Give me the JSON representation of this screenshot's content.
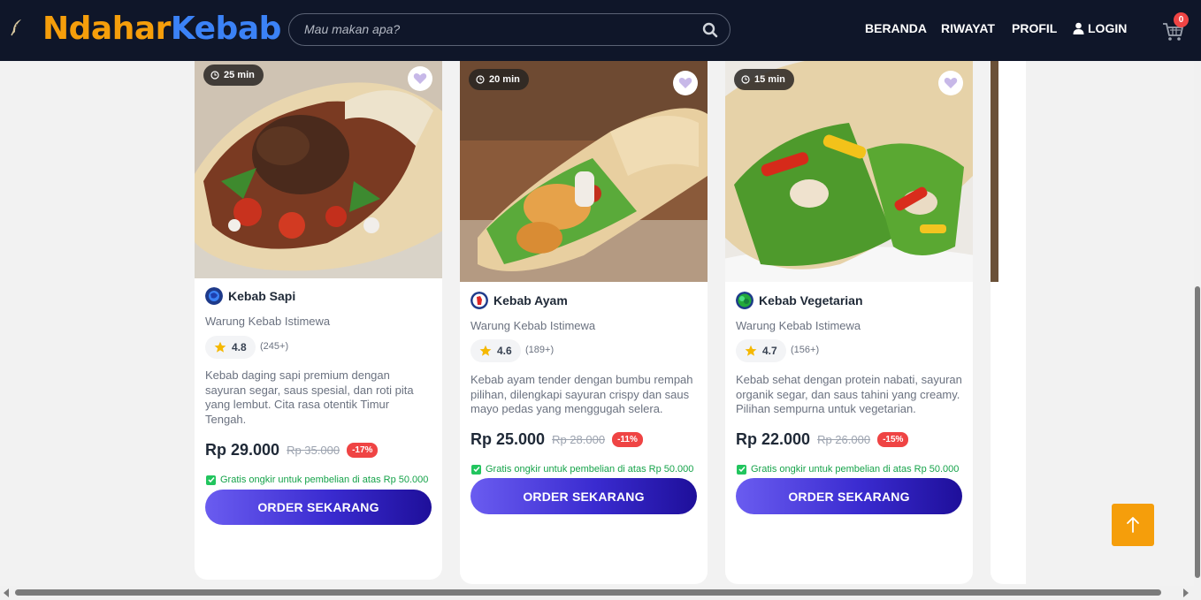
{
  "header": {
    "logo_part1": "Ndahar",
    "logo_part2": "Kebab",
    "search_placeholder": "Mau makan apa?",
    "nav": [
      "BERANDA",
      "RIWAYAT",
      "PROFIL",
      "LOGIN"
    ],
    "cart_count": "0"
  },
  "cards": [
    {
      "time": "25 min",
      "title": "Kebab Sapi",
      "store": "Warung Kebab Istimewa",
      "rating": "4.8",
      "reviews": "(245+)",
      "description": "Kebab daging sapi premium dengan sayuran segar, saus spesial, dan roti pita yang lembut. Cita rasa otentik Timur Tengah.",
      "price": "Rp 29.000",
      "old_price": "Rp 35.000",
      "discount": "-17%",
      "shipping": "Gratis ongkir untuk pembelian di atas Rp 50.000",
      "order_label": "ORDER SEKARANG"
    },
    {
      "time": "20 min",
      "title": "Kebab Ayam",
      "store": "Warung Kebab Istimewa",
      "rating": "4.6",
      "reviews": "(189+)",
      "description": "Kebab ayam tender dengan bumbu rempah pilihan, dilengkapi sayuran crispy dan saus mayo pedas yang menggugah selera.",
      "price": "Rp 25.000",
      "old_price": "Rp 28.000",
      "discount": "-11%",
      "shipping": "Gratis ongkir untuk pembelian di atas Rp 50.000",
      "order_label": "ORDER SEKARANG"
    },
    {
      "time": "15 min",
      "title": "Kebab Vegetarian",
      "store": "Warung Kebab Istimewa",
      "rating": "4.7",
      "reviews": "(156+)",
      "description": "Kebab sehat dengan protein nabati, sayuran organik segar, dan saus tahini yang creamy. Pilihan sempurna untuk vegetarian.",
      "price": "Rp 22.000",
      "old_price": "Rp 26.000",
      "discount": "-15%",
      "shipping": "Gratis ongkir untuk pembelian di atas Rp 50.000",
      "order_label": "ORDER SEKARANG"
    }
  ],
  "colors": {
    "header_bg": "#0f1629",
    "logo_orange": "#f59e0b",
    "logo_blue": "#3b82f6",
    "discount_red": "#ef4444",
    "shipping_green": "#16a34a",
    "back_to_top": "#f59e0b"
  },
  "icons": [
    "feather-icon",
    "search-icon",
    "user-icon",
    "cart-icon",
    "clock-icon",
    "heart-icon",
    "star-icon",
    "check-icon",
    "arrow-up-icon",
    "beef-icon",
    "chicken-icon",
    "veggie-icon"
  ]
}
